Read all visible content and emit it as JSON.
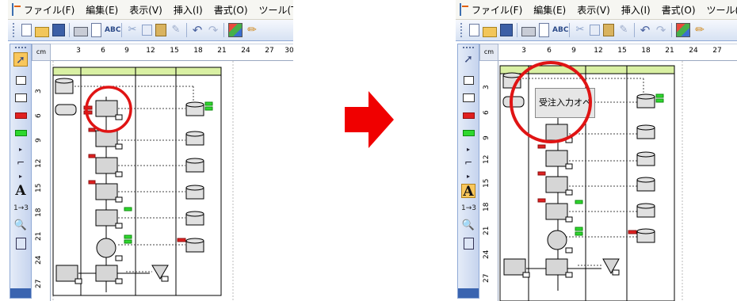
{
  "menu": {
    "left": [
      "ファイル(F)",
      "編集(E)",
      "表示(V)",
      "挿入(I)",
      "書式(O)",
      "ツール(T)"
    ],
    "right": [
      "ファイル(F)",
      "編集(E)",
      "表示(V)",
      "挿入(I)",
      "書式(O)",
      "ツール(T)"
    ]
  },
  "ruler": {
    "unit": "cm",
    "h_ticks": [
      "3",
      "6",
      "9",
      "12",
      "15",
      "18",
      "21",
      "24",
      "27",
      "30"
    ],
    "v_ticks": [
      "3",
      "6",
      "9",
      "12",
      "15",
      "18",
      "21",
      "24",
      "27"
    ],
    "right_h_ticks": [
      "3",
      "6",
      "9",
      "12",
      "15",
      "18",
      "21",
      "24",
      "27"
    ],
    "right_v_ticks": [
      "3",
      "6",
      "9",
      "12",
      "15",
      "18",
      "21",
      "24",
      "27"
    ]
  },
  "after": {
    "process_label": "受注入力オペ"
  },
  "colors": {
    "highlight": "#e01414",
    "lane_header": "#d9f0a3",
    "tag_red": "#e02020",
    "tag_green": "#2ed82e",
    "arrow": "#f00000"
  }
}
